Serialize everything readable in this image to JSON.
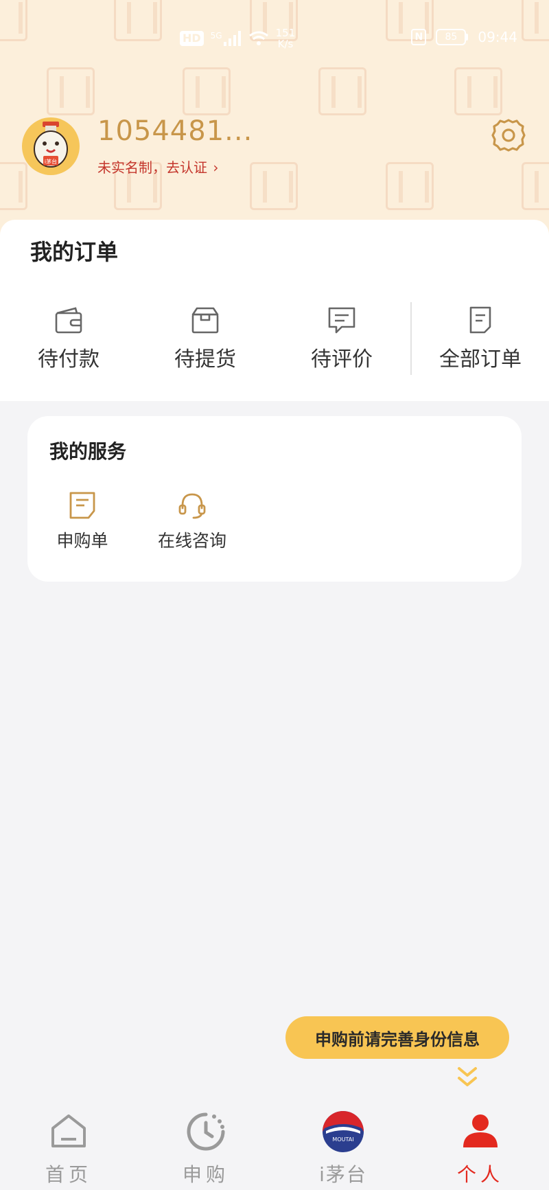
{
  "status_bar": {
    "network_badge": "HD",
    "signal_label": "5G",
    "speed_value": "151",
    "speed_unit": "K/s",
    "nfc_label": "N",
    "battery": "85",
    "time": "09:44"
  },
  "profile": {
    "username": "1054481...",
    "verify_text": "未实名制，去认证",
    "avatar_badge": "i茅台"
  },
  "orders": {
    "title": "我的订单",
    "items": [
      {
        "label": "待付款",
        "icon": "wallet-icon"
      },
      {
        "label": "待提货",
        "icon": "box-icon"
      },
      {
        "label": "待评价",
        "icon": "comment-icon"
      },
      {
        "label": "全部订单",
        "icon": "document-icon"
      }
    ]
  },
  "services": {
    "title": "我的服务",
    "items": [
      {
        "label": "申购单",
        "icon": "form-icon"
      },
      {
        "label": "在线咨询",
        "icon": "headset-icon"
      }
    ]
  },
  "tip": {
    "text": "申购前请完善身份信息"
  },
  "tabbar": {
    "items": [
      {
        "label": "首页",
        "icon": "home-icon"
      },
      {
        "label": "申购",
        "icon": "clock-icon"
      },
      {
        "label": "i茅台",
        "icon": "moutai-logo-icon",
        "logo_text": "MOUTAI"
      },
      {
        "label": "个人",
        "icon": "person-icon",
        "active": true
      }
    ]
  },
  "colors": {
    "brand_gold": "#c8964a",
    "accent_red": "#e3291f",
    "tip_yellow": "#f8c553",
    "header_bg": "#fcefdb"
  }
}
